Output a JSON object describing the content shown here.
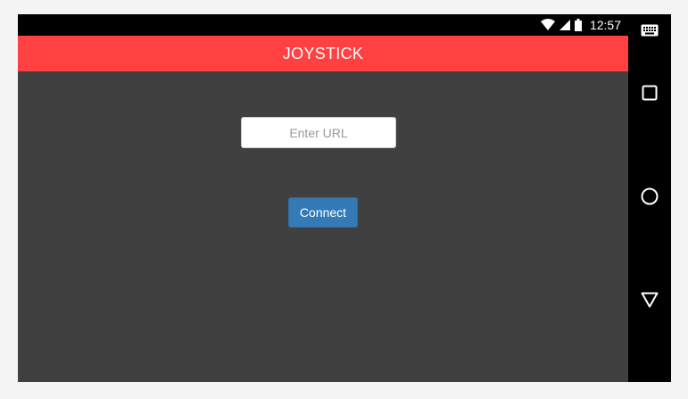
{
  "status_bar": {
    "time": "12:57",
    "icons": [
      "wifi-icon",
      "cell-signal-icon",
      "battery-icon"
    ]
  },
  "app": {
    "title": "JOYSTICK",
    "url_input": {
      "value": "",
      "placeholder": "Enter URL"
    },
    "connect_label": "Connect"
  },
  "nav_bar": {
    "buttons": [
      "keyboard-icon",
      "recents-icon",
      "home-icon",
      "back-icon"
    ]
  },
  "colors": {
    "title_bar": "#ff4141",
    "app_background": "#404040",
    "connect_button": "#337ab7"
  }
}
